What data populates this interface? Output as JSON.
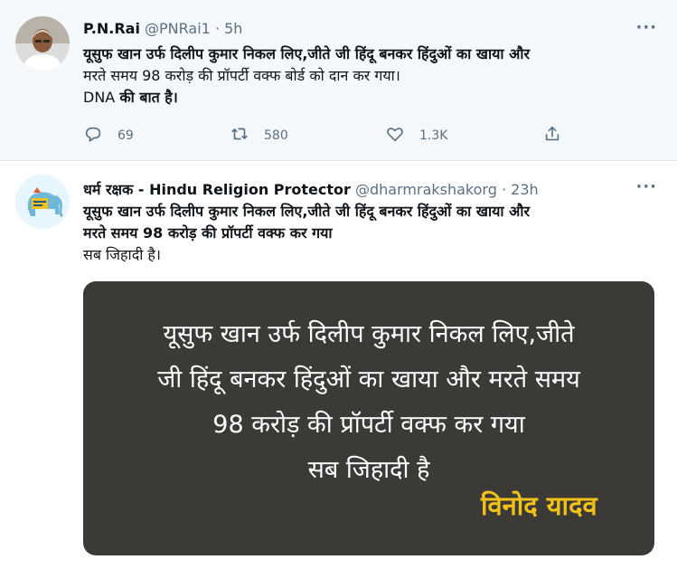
{
  "tweets": [
    {
      "name": "P.N.Rai",
      "handle": "@PNRai1",
      "separator": "·",
      "time": "5h",
      "text_lines": [
        "यूसुफ खान उर्फ दिलीप कुमार निकल लिए,जीते जी हिंदू बनकर हिंदुओं का खाया और",
        "मरते समय 98 करोड़ की प्रॉपर्टी वक्फ बोर्ड को दान कर गया।"
      ],
      "last_line": {
        "plain": "DNA ",
        "bold": "की बात है।"
      },
      "actions": {
        "reply_count": "69",
        "retweet_count": "580",
        "like_count": "1.3K"
      }
    },
    {
      "name": "धर्म रक्षक - Hindu Religion Protector",
      "handle": "@dharmrakshakorg",
      "separator": "·",
      "time": "23h",
      "text_lines": [
        "यूसुफ खान उर्फ दिलीप कुमार निकल लिए,जीते जी हिंदू बनकर हिंदुओं का खाया और",
        "मरते समय 98 करोड़ की प्रॉपर्टी वक्फ कर गया",
        "सब जिहादी है।"
      ],
      "image": {
        "lines": [
          "यूसुफ खान उर्फ दिलीप कुमार निकल लिए,जीते",
          "जी हिंदू बनकर हिंदुओं का खाया और मरते समय",
          "98 करोड़ की प्रॉपर्टी वक्फ कर गया",
          "सब जिहादी है"
        ],
        "signature": "विनोद यादव"
      }
    }
  ],
  "icons": {
    "more": "more-horizontal-icon",
    "reply": "reply-icon",
    "retweet": "retweet-icon",
    "like": "like-icon",
    "share": "share-icon"
  },
  "colors": {
    "secondary_text": "#5b7083",
    "highlight_bg": "#f5f8fa",
    "image_bg": "#3b3a36",
    "signature": "#f2c21b"
  }
}
